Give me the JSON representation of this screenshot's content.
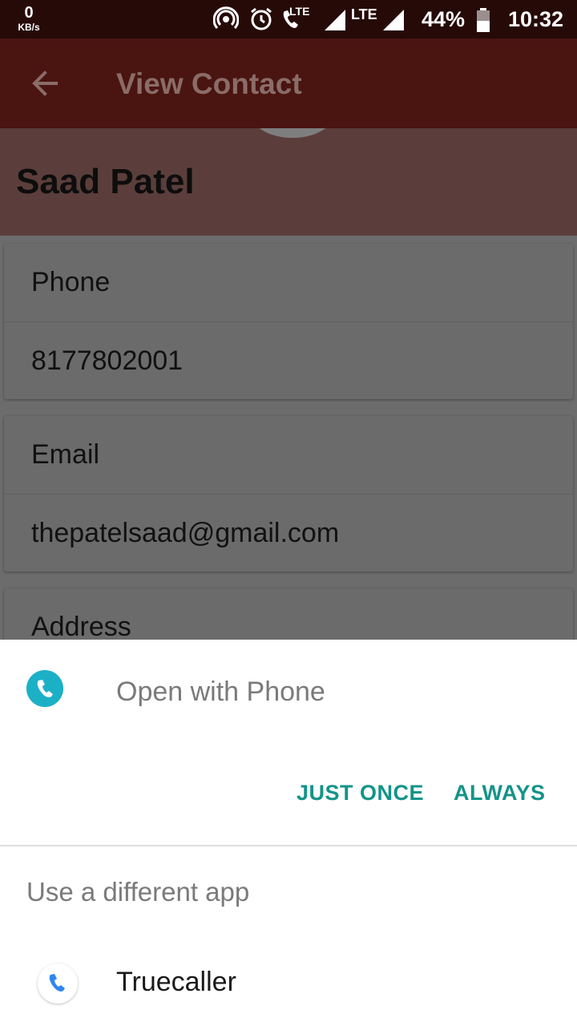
{
  "status_bar": {
    "speed_value": "0",
    "speed_unit": "KB/s",
    "lte1": "LTE",
    "lte2": "LTE",
    "battery": "44%",
    "time": "10:32"
  },
  "app_bar": {
    "title": "View Contact"
  },
  "contact": {
    "name": "Saad Patel",
    "phone_label": "Phone",
    "phone_value": "8177802001",
    "email_label": "Email",
    "email_value": "thepatelsaad@gmail.com",
    "address_label": "Address"
  },
  "sheet": {
    "open_with": "Open with Phone",
    "just_once": "JUST ONCE",
    "always": "ALWAYS",
    "different_app": "Use a different app",
    "apps": [
      {
        "label": "Truecaller",
        "icon": "truecaller-phone-icon"
      }
    ]
  },
  "colors": {
    "status_bar": "#260a08",
    "app_bar": "#4a1411",
    "accent_button": "#139488",
    "phone_icon": "#1cb0c7",
    "truecaller_icon": "#2f86f0"
  }
}
